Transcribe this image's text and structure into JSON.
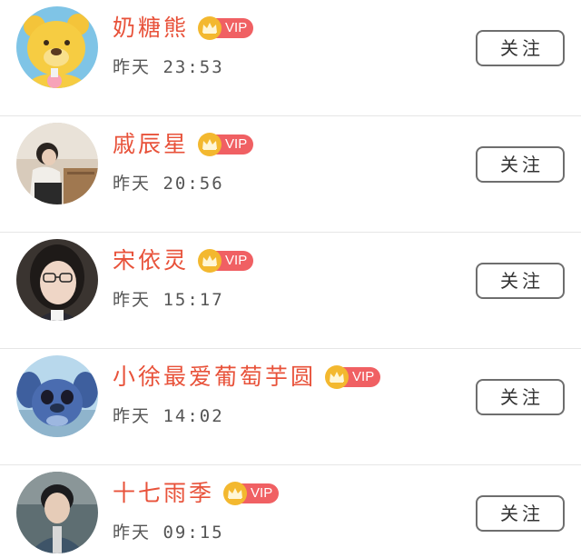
{
  "follow_list": [
    {
      "name": "奶糖熊",
      "vip_label": "VIP",
      "time": "昨天 23:53",
      "follow_label": "关注",
      "avatar_icon": "yellow-bear-avatar"
    },
    {
      "name": "戚辰星",
      "vip_label": "VIP",
      "time": "昨天 20:56",
      "follow_label": "关注",
      "avatar_icon": "girl-sitting-photo-avatar"
    },
    {
      "name": "宋依灵",
      "vip_label": "VIP",
      "time": "昨天 15:17",
      "follow_label": "关注",
      "avatar_icon": "girl-glasses-photo-avatar"
    },
    {
      "name": "小徐最爱葡萄芋圆",
      "vip_label": "VIP",
      "time": "昨天 14:02",
      "follow_label": "关注",
      "avatar_icon": "stitch-cartoon-avatar"
    },
    {
      "name": "十七雨季",
      "vip_label": "VIP",
      "time": "昨天 09:15",
      "follow_label": "关注",
      "avatar_icon": "boy-photo-avatar"
    }
  ],
  "colors": {
    "name": "#e8523a",
    "vip_badge": "#f06063",
    "vip_crown": "#f3b82f",
    "time_text": "#555555",
    "button_border": "#6e6e6e",
    "divider": "#e6e6e6"
  }
}
